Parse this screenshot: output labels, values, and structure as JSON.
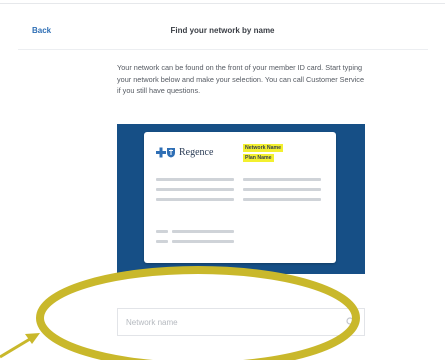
{
  "header": {
    "back_label": "Back",
    "title": "Find your network by name"
  },
  "instructions": "Your network can be found on the front of your member ID card. Start typing your network below and make your selection. You can call Customer Service if you still have questions.",
  "card": {
    "brand": "Regence",
    "highlight_network": "Network Name",
    "highlight_plan": "Plan Name"
  },
  "search": {
    "value": "",
    "placeholder": "Network name"
  },
  "colors": {
    "accent": "#2f6fb5",
    "card_background": "#164f86",
    "highlight": "#f3f02f",
    "annotation": "#c9b82b"
  },
  "icons": {
    "logo": "cross-and-shield-logo",
    "search": "search-icon",
    "annotation_ring": "ellipse-annotation",
    "annotation_arrow": "arrow-annotation"
  }
}
